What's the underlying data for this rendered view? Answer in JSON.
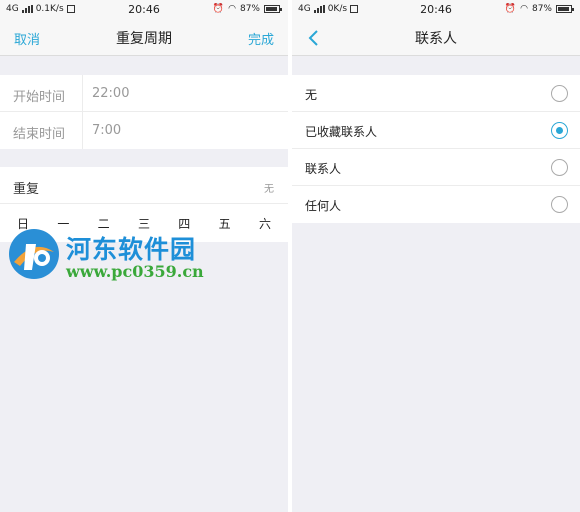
{
  "left_screen": {
    "status_bar": {
      "network": "4G",
      "speed": "0.1K/s",
      "time": "20:46",
      "battery": "87%"
    },
    "nav": {
      "cancel_label": "取消",
      "title": "重复周期",
      "done_label": "完成",
      "accent_color": "#2aa7d6"
    },
    "time_fields": [
      {
        "label": "开始时间",
        "value": "22:00"
      },
      {
        "label": "结束时间",
        "value": "7:00"
      }
    ],
    "repeat": {
      "label": "重复",
      "value": "无",
      "days": [
        "日",
        "一",
        "二",
        "三",
        "四",
        "五",
        "六"
      ]
    },
    "watermark": {
      "name": "河东软件园",
      "url": "www.pc0359.cn"
    }
  },
  "right_screen": {
    "status_bar": {
      "network": "4G",
      "speed": "0K/s",
      "time": "20:46",
      "battery": "87%"
    },
    "nav": {
      "back_icon": "chevron-left-icon",
      "title": "联系人"
    },
    "options": [
      {
        "label": "无",
        "selected": false
      },
      {
        "label": "已收藏联系人",
        "selected": true
      },
      {
        "label": "联系人",
        "selected": false
      },
      {
        "label": "任何人",
        "selected": false
      }
    ]
  }
}
